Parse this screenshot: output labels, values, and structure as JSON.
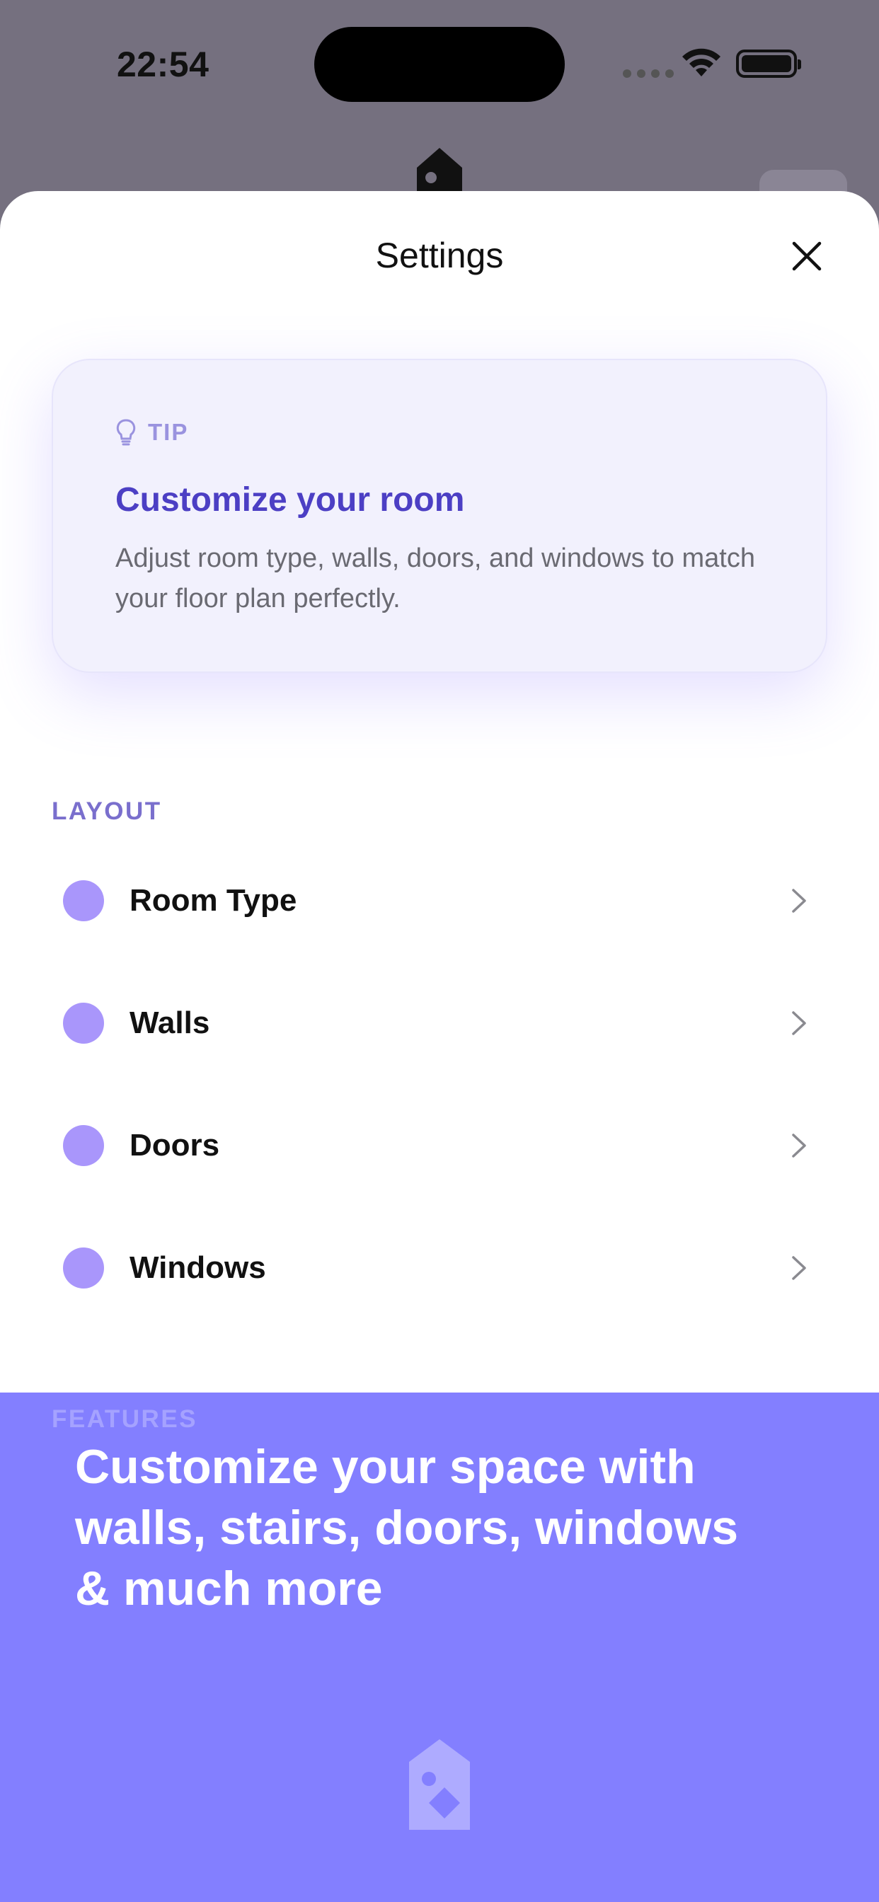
{
  "status_bar": {
    "time": "22:54"
  },
  "sheet": {
    "title": "Settings"
  },
  "tip": {
    "label": "TIP",
    "heading": "Customize your room",
    "body": "Adjust room type, walls, doors, and windows to match your floor plan perfectly."
  },
  "layout_section": {
    "header": "LAYOUT",
    "items": [
      {
        "label": "Room Type"
      },
      {
        "label": "Walls"
      },
      {
        "label": "Doors"
      },
      {
        "label": "Windows"
      }
    ]
  },
  "features_section": {
    "header": "FEATURES"
  },
  "promo": {
    "text": "Customize your space with walls, stairs, doors, windows & much more"
  },
  "colors": {
    "accent": "#4c3fc4",
    "dot": "#a996fb",
    "promo_bg": "#7e7aff",
    "tip_bg": "#f2f1fd"
  }
}
